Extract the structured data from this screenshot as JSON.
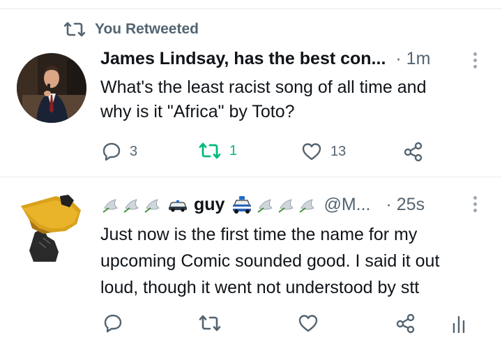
{
  "colors": {
    "text": "#0f1419",
    "secondary": "#536471",
    "retweet_green": "#00ba7c",
    "divider": "#e6ecf0"
  },
  "tweet1": {
    "retweet_label": "You Retweeted",
    "author": "James Lindsay, has the best con...",
    "time": "· 1m",
    "text_line1": "What's the least racist song of all time and",
    "text_line2": "why is it \"Africa\" by Toto?",
    "replies": "3",
    "retweets": "1",
    "likes": "13"
  },
  "tweet2": {
    "name": "guy",
    "handle": "@M...",
    "time": "· 25s",
    "text_line1": "Just now is the first time the name for my",
    "text_line2": "upcoming Comic sounded good. I said it out",
    "text_line3": "loud, though it went not understood by stt"
  }
}
